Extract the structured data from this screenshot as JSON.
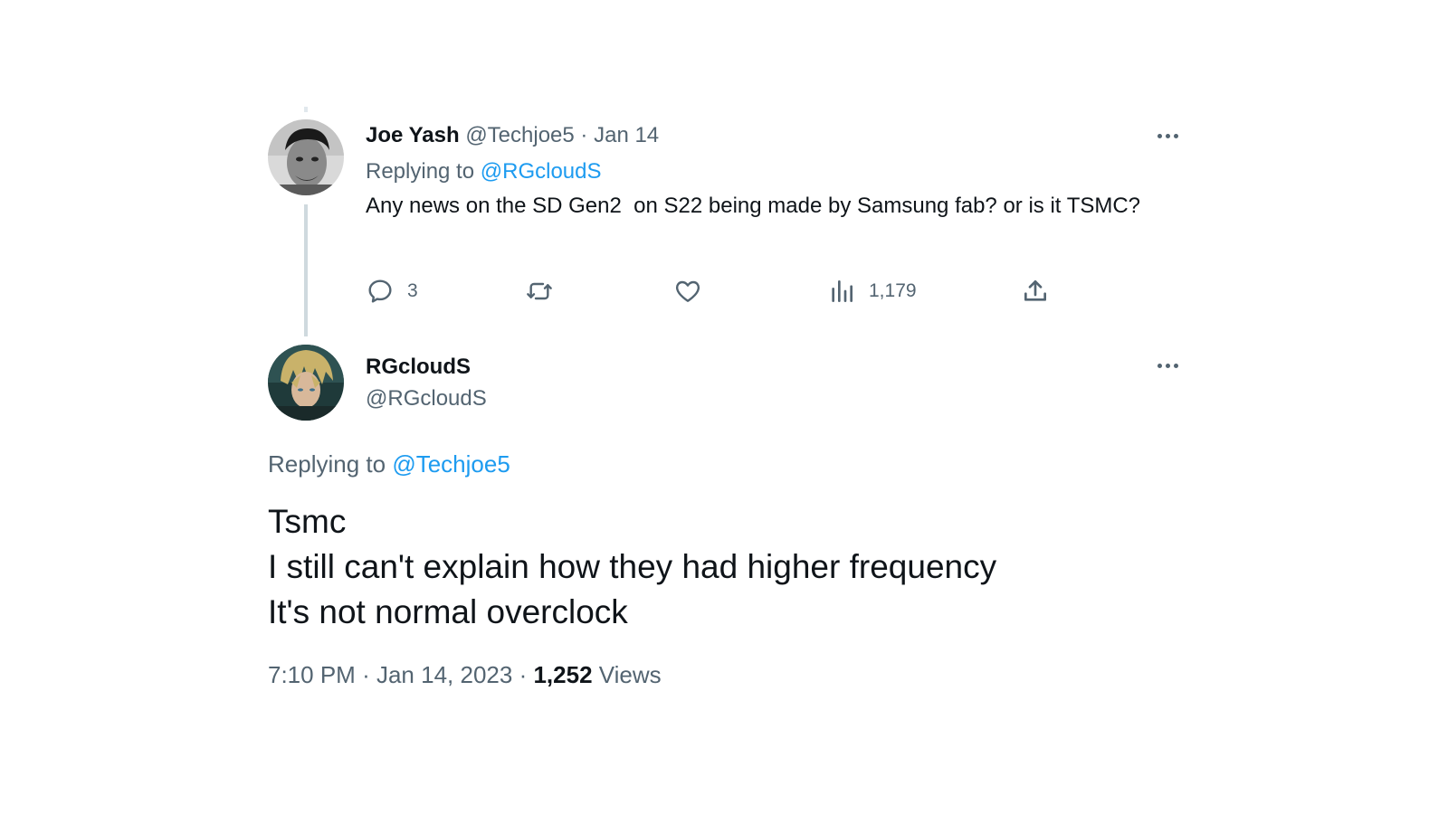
{
  "parent_tweet": {
    "display_name": "Joe Yash",
    "handle": "@Techjoe5",
    "separator": "·",
    "date": "Jan 14",
    "replying_prefix": "Replying to",
    "replying_to": "@RGcloudS",
    "text": "Any news on the SD Gen2  on S22 being made by Samsung fab? or is it TSMC?",
    "reply_count": "3",
    "views_count": "1,179",
    "icons": [
      "reply-icon",
      "retweet-icon",
      "like-icon",
      "views-icon",
      "share-icon",
      "more-icon"
    ]
  },
  "reply_tweet": {
    "display_name": "RGcloudS",
    "handle": "@RGcloudS",
    "replying_prefix": "Replying to",
    "replying_to": "@Techjoe5",
    "text_lines": [
      "Tsmc",
      "I still can't explain how they had higher frequency",
      "It's not normal overclock"
    ],
    "time": "7:10 PM",
    "separator": "·",
    "date": "Jan 14, 2023",
    "views_count": "1,252",
    "views_label": "Views"
  },
  "colors": {
    "text": "#0f1419",
    "muted": "#536471",
    "link": "#1d9bf0",
    "thread_line": "#cfd9de"
  }
}
